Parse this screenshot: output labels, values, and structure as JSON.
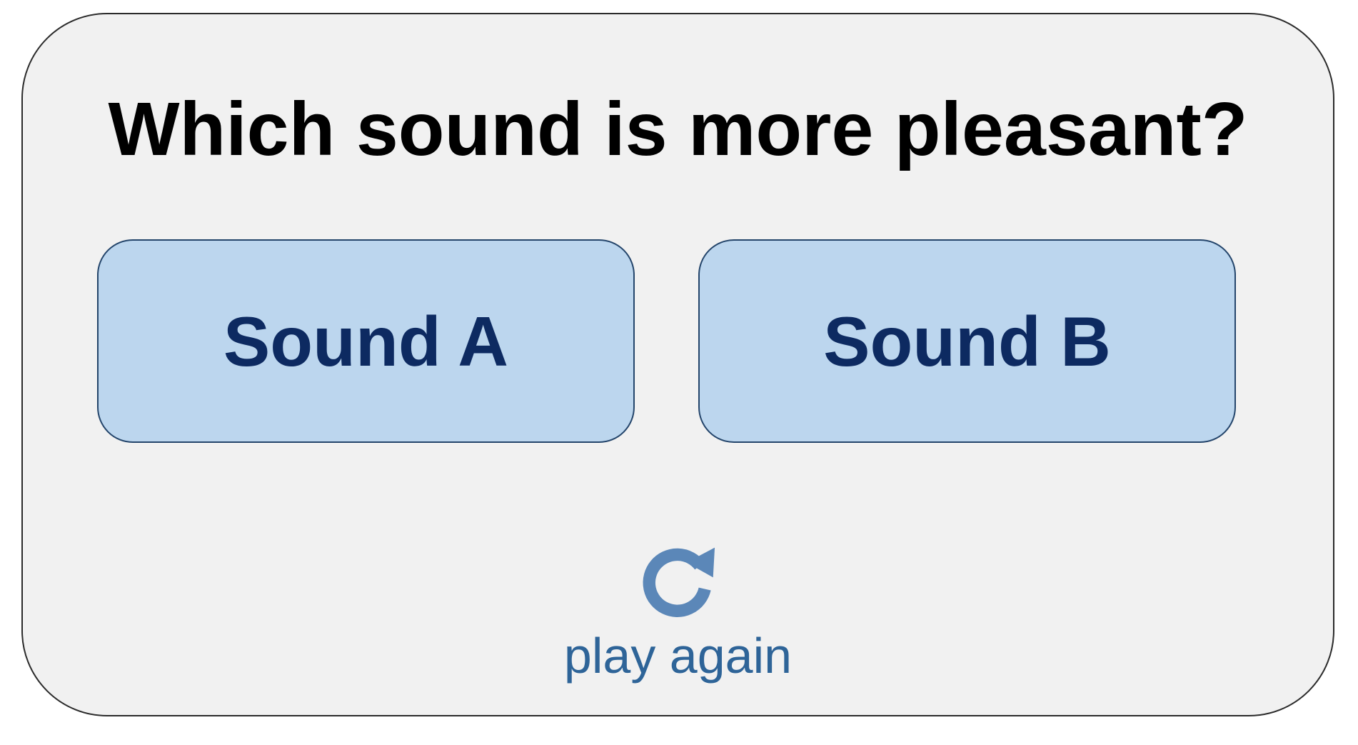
{
  "question": {
    "text": "Which sound is more pleasant?"
  },
  "choices": [
    {
      "label": "Sound A"
    },
    {
      "label": "Sound B"
    }
  ],
  "replay": {
    "label": "play again",
    "icon": "refresh-icon"
  },
  "colors": {
    "card_background": "#f1f1f1",
    "button_background": "#bcd6ee",
    "button_text": "#0d2a61",
    "replay_accent": "#2e6498",
    "replay_icon": "#5b87b8"
  }
}
